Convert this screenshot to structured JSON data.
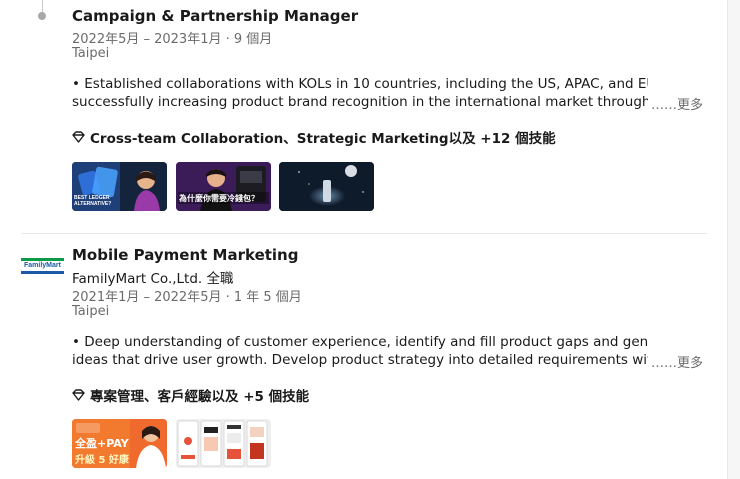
{
  "exp1": {
    "title": "Campaign & Partnership Manager",
    "dates": "2022年5月 – 2023年1月 · 9 個月",
    "location": "Taipei",
    "desc_line1": "• Established collaborations with KOLs in 10 countries, including the US, APAC, and EU,",
    "desc_line2": "successfully increasing product brand recognition in the international market through expo",
    "more": "……更多",
    "skills": "Cross-team Collaboration、Strategic Marketing以及 +12 個技能",
    "thumb1_text": "BEST LEDGER ALTERNATIVE?",
    "thumb2_text": "為什麼你需要冷錢包？"
  },
  "exp2": {
    "title": "Mobile Payment Marketing",
    "company": "FamilyMart Co.,Ltd. 全職",
    "logo_text": "FamilyMart",
    "dates": "2021年1月 – 2022年5月 · 1 年 5 個月",
    "location": "Taipei",
    "desc_line1": "• Deep understanding of customer experience, identify and fill product gaps and generate new",
    "desc_line2": "ideas that drive user growth. Develop product strategy into detailed requirements with cros",
    "more": "……更多",
    "skills": "專案管理、客戶經驗以及 +5 個技能",
    "thumb1_line1": "全盈+PAY",
    "thumb1_line2": "升級 5 好康"
  },
  "colors": {
    "familymart_green": "#0a9a48",
    "familymart_blue": "#1c5aa8",
    "pay_orange": "#f06a2a"
  }
}
